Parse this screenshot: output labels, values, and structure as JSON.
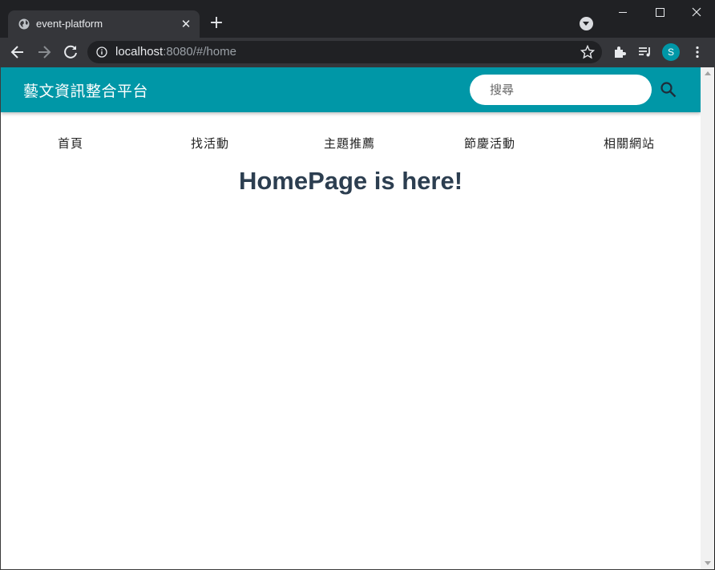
{
  "browser": {
    "tab_title": "event-platform",
    "url_host": "localhost",
    "url_rest": ":8080/#/home",
    "profile_initial": "S"
  },
  "header": {
    "brand": "藝文資訊整合平台",
    "search_placeholder": "搜尋"
  },
  "nav": {
    "items": [
      "首頁",
      "找活動",
      "主題推薦",
      "節慶活動",
      "相關網站"
    ]
  },
  "main": {
    "heading": "HomePage is here!"
  },
  "colors": {
    "header_bg": "#0097a7",
    "heading": "#2c3e50"
  }
}
